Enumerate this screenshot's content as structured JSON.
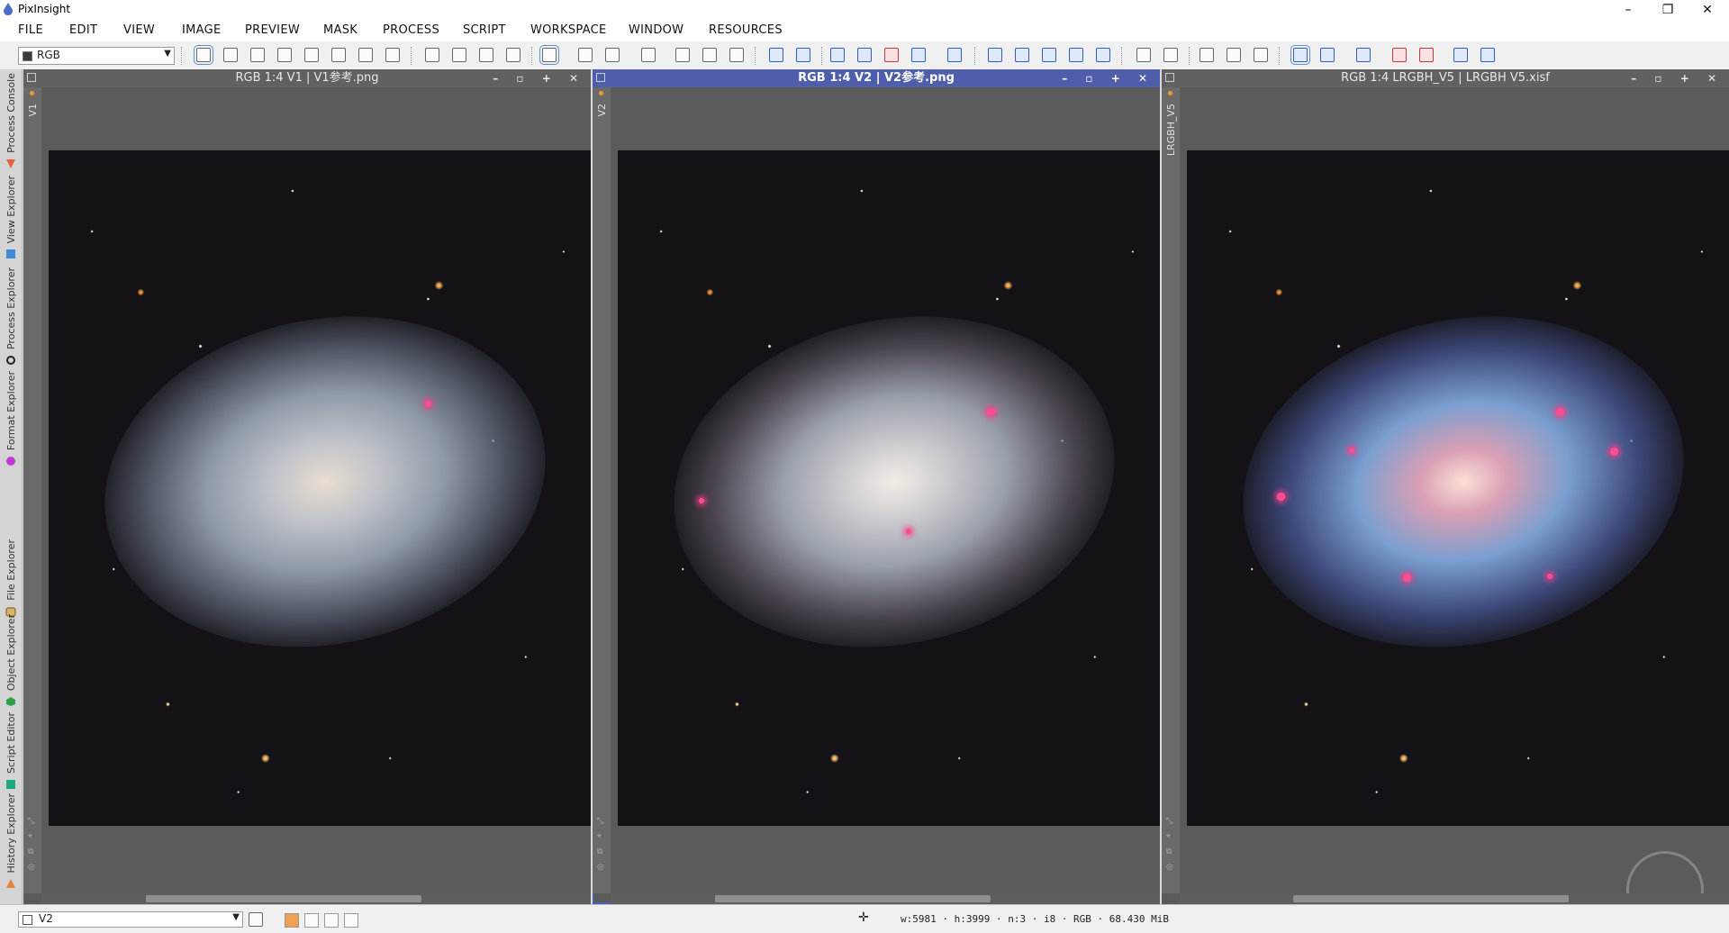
{
  "app": {
    "title": "PixInsight",
    "accent_color": "#4e5eaa"
  },
  "window_controls": {
    "minimize": "–",
    "maximize": "❐",
    "close": "✕"
  },
  "menu": [
    "FILE",
    "EDIT",
    "VIEW",
    "IMAGE",
    "PREVIEW",
    "MASK",
    "PROCESS",
    "SCRIPT",
    "WORKSPACE",
    "WINDOW",
    "RESOURCES"
  ],
  "toolbar": {
    "image_select": "RGB"
  },
  "left_dock": [
    {
      "label": "Process Console",
      "icon": "console-icon"
    },
    {
      "label": "View Explorer",
      "icon": "view-explorer-icon"
    },
    {
      "label": "Process Explorer",
      "icon": "gear-icon"
    },
    {
      "label": "Format Explorer",
      "icon": "format-icon"
    },
    {
      "label": "File Explorer",
      "icon": "file-icon"
    },
    {
      "label": "Object Explorer",
      "icon": "object-icon"
    },
    {
      "label": "Script Editor",
      "icon": "script-icon"
    },
    {
      "label": "History Explorer",
      "icon": "history-icon"
    }
  ],
  "image_windows": [
    {
      "title": "RGB 1:4 V1 | V1参考.png",
      "view_id": "V1",
      "active": false
    },
    {
      "title": "RGB 1:4 V2 | V2参考.png",
      "view_id": "V2",
      "active": true
    },
    {
      "title": "RGB 1:4 LRGBH_V5 | LRGBH V5.xisf",
      "view_id": "LRGBH_V5",
      "active": false
    }
  ],
  "win_buttons": "– ▫ + ✕",
  "statusbar": {
    "view_select": "V2",
    "info": "w:5981 · h:3999 · n:3 · i8 · RGB · 68.430 MiB"
  }
}
